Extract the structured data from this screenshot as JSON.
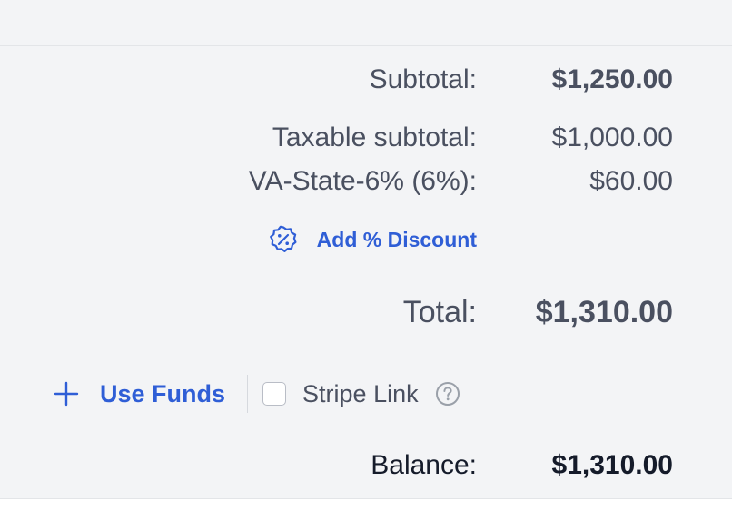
{
  "summary": {
    "subtotal_label": "Subtotal:",
    "subtotal_value": "$1,250.00",
    "taxable_label": "Taxable subtotal:",
    "taxable_value": "$1,000.00",
    "tax_label": "VA-State-6% (6%):",
    "tax_value": "$60.00",
    "discount_action": "Add % Discount",
    "discount_icon": "percent-badge-icon",
    "total_label": "Total:",
    "total_value": "$1,310.00",
    "balance_label": "Balance:",
    "balance_value": "$1,310.00"
  },
  "funds": {
    "use_funds_label": "Use Funds",
    "use_funds_icon": "plus-icon",
    "stripe_link_label": "Stripe Link",
    "stripe_link_checked": false,
    "help_icon": "question-circle-icon"
  },
  "colors": {
    "accent": "#2f5ed6",
    "text": "#4a5060",
    "text_strong": "#151b2a",
    "panel_bg": "#f3f4f6"
  }
}
